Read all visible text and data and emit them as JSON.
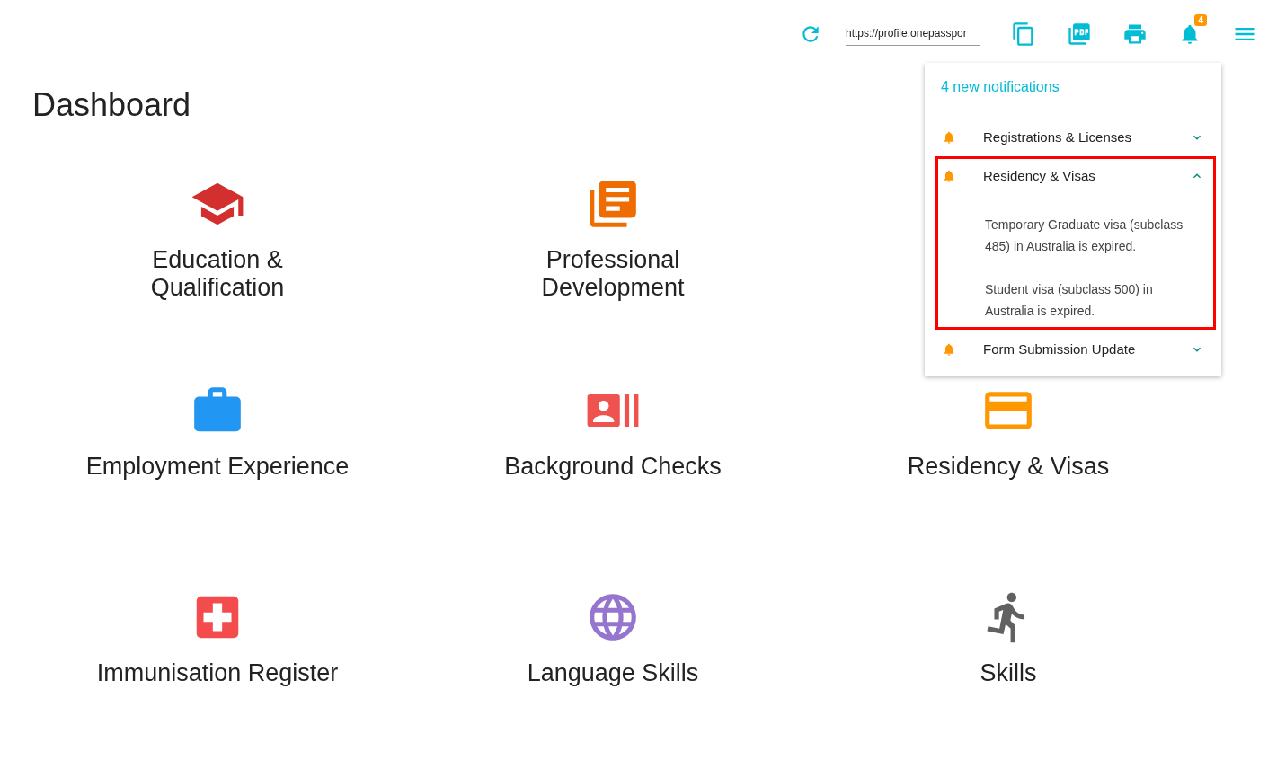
{
  "toolbar": {
    "url": "https://profile.onepasspor",
    "notification_count": "4"
  },
  "title": "Dashboard",
  "tile_rows": [
    [
      {
        "label": "Education & Qualification",
        "color": "#d32f2f"
      },
      {
        "label": "Professional Development",
        "color": "#ef6c00"
      }
    ],
    [
      {
        "label": "Employment Experience",
        "color": "#2196f3"
      },
      {
        "label": "Background Checks",
        "color": "#ef5350"
      },
      {
        "label": "Residency & Visas",
        "color": "#ff9800"
      }
    ],
    [
      {
        "label": "Immunisation Register",
        "color": "#f44c4c"
      },
      {
        "label": "Language Skills",
        "color": "#9575cd"
      },
      {
        "label": "Skills",
        "color": "#616161"
      }
    ]
  ],
  "notifications": {
    "header": "4 new notifications",
    "groups": [
      {
        "title": "Registrations & Licenses",
        "expanded": false,
        "highlighted": false
      },
      {
        "title": "Residency & Visas",
        "expanded": true,
        "highlighted": true,
        "messages": [
          "Temporary Graduate visa (subclass 485) in Australia is expired.",
          "Student visa (subclass 500) in Australia is expired."
        ]
      },
      {
        "title": "Form Submission Update",
        "expanded": false,
        "highlighted": false
      }
    ]
  }
}
